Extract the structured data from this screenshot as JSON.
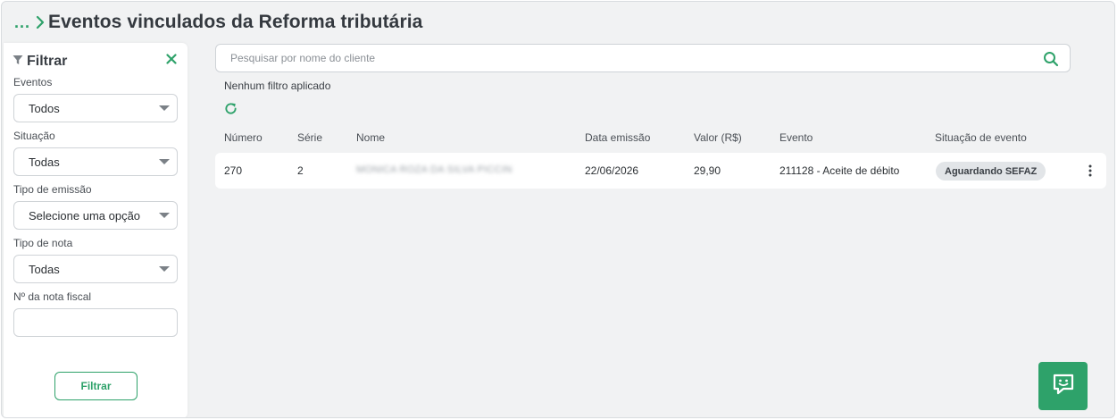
{
  "header": {
    "breadcrumb_dots": "...",
    "title": "Eventos vinculados da Reforma tributária"
  },
  "sidebar": {
    "title": "Filtrar",
    "fields": [
      {
        "label": "Eventos",
        "value": "Todos"
      },
      {
        "label": "Situação",
        "value": "Todas"
      },
      {
        "label": "Tipo de emissão",
        "value": "Selecione uma opção"
      },
      {
        "label": "Tipo de nota",
        "value": "Todas"
      },
      {
        "label": "Nº da nota fiscal",
        "value": ""
      }
    ],
    "filter_button": "Filtrar"
  },
  "search": {
    "placeholder": "Pesquisar por nome do cliente"
  },
  "status_text": "Nenhum filtro aplicado",
  "table": {
    "columns": [
      "Número",
      "Série",
      "Nome",
      "Data emissão",
      "Valor (R$)",
      "Evento",
      "Situação de evento"
    ],
    "rows": [
      {
        "numero": "270",
        "serie": "2",
        "nome": "MONICA ROZA DA SILVA PICCIN",
        "data_emissao": "22/06/2026",
        "valor": "29,90",
        "evento": "211128 - Aceite de débito",
        "situacao": "Aguardando SEFAZ"
      }
    ]
  },
  "colors": {
    "accent": "#2ea26a",
    "background": "#f1f2f3",
    "badge_bg": "#e2e5e8"
  },
  "icons": {
    "breadcrumb": "chevron-right-icon",
    "filter": "funnel-icon",
    "close": "close-icon",
    "search": "search-icon",
    "refresh": "refresh-icon",
    "more": "more-vertical-icon",
    "chat": "chat-icon"
  }
}
